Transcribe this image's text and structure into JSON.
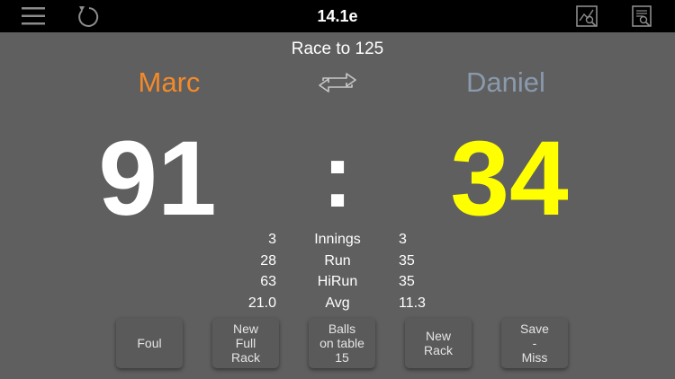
{
  "header": {
    "title": "14.1e"
  },
  "match": {
    "race_label": "Race to 125"
  },
  "players": {
    "left": {
      "name": "Marc",
      "score": "91",
      "name_color": "#f38a2a",
      "score_color": "#ffffff"
    },
    "right": {
      "name": "Daniel",
      "score": "34",
      "name_color": "#8a9aac",
      "score_color": "#ffff00"
    }
  },
  "scoreboard": {
    "separator": ":"
  },
  "stats": [
    {
      "label": "Innings",
      "left": "3",
      "right": "3"
    },
    {
      "label": "Run",
      "left": "28",
      "right": "35"
    },
    {
      "label": "HiRun",
      "left": "63",
      "right": "35"
    },
    {
      "label": "Avg",
      "left": "21.0",
      "right": "11.3"
    }
  ],
  "buttons": {
    "foul": "Foul",
    "new_full_rack": "New\nFull\nRack",
    "balls_on_table": "Balls\non table\n15",
    "new_rack": "New\nRack",
    "save_miss": "Save\n-\nMiss"
  },
  "icons": {
    "menu": "hamburger-menu-icon",
    "undo": "undo-icon",
    "chart": "chart-magnifier-icon",
    "report": "document-search-icon",
    "swap": "swap-arrows-icon"
  }
}
